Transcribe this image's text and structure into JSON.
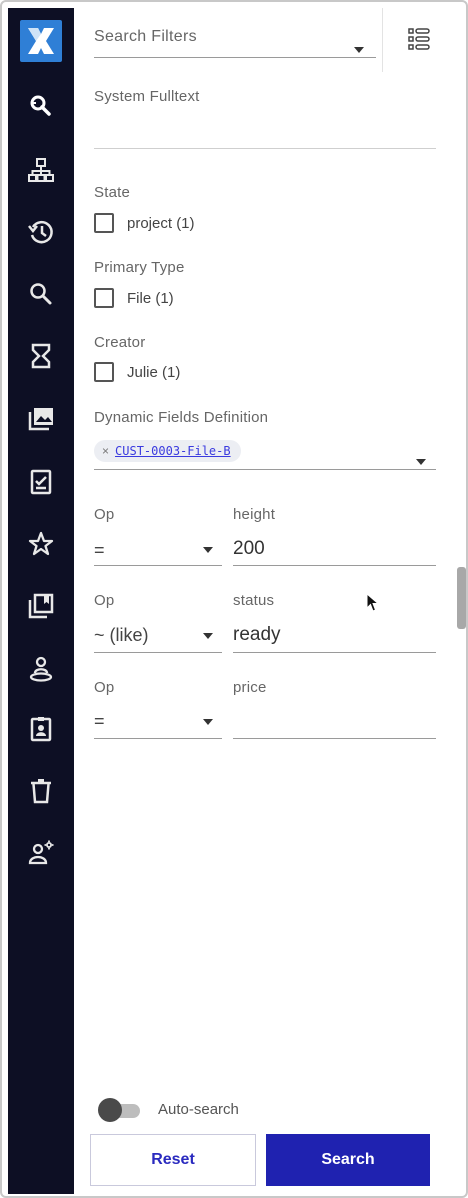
{
  "header": {
    "search_filters_label": "Search Filters"
  },
  "sidebar": {
    "items": [
      {
        "icon": "search-zoom-icon"
      },
      {
        "icon": "hierarchy-icon"
      },
      {
        "icon": "history-icon"
      },
      {
        "icon": "search-icon"
      },
      {
        "icon": "hourglass-icon"
      },
      {
        "icon": "collections-icon"
      },
      {
        "icon": "tasks-icon"
      },
      {
        "icon": "star-icon"
      },
      {
        "icon": "library-icon"
      },
      {
        "icon": "user-location-icon"
      },
      {
        "icon": "badge-icon"
      },
      {
        "icon": "trash-icon"
      },
      {
        "icon": "user-settings-icon"
      }
    ]
  },
  "filters": {
    "fulltext_label": "System Fulltext",
    "state_label": "State",
    "state_option": "project (1)",
    "primary_type_label": "Primary Type",
    "primary_type_option": "File (1)",
    "creator_label": "Creator",
    "creator_option": "Julie (1)",
    "dynamic_label": "Dynamic Fields Definition",
    "dynamic_chip": "CUST-0003-File-B",
    "dynamic_chip_remove": "×",
    "rows": [
      {
        "op_label": "Op",
        "op_value": "=",
        "field_label": "height",
        "field_value": "200"
      },
      {
        "op_label": "Op",
        "op_value": "~ (like)",
        "field_label": "status",
        "field_value": "ready"
      },
      {
        "op_label": "Op",
        "op_value": "=",
        "field_label": "price",
        "field_value": ""
      }
    ]
  },
  "footer": {
    "auto_search_label": "Auto-search",
    "reset_label": "Reset",
    "search_label": "Search"
  },
  "colors": {
    "sidebar_bg": "#0d0f24",
    "logo_bg": "#2f7fd6",
    "primary_button": "#1f22b0",
    "chip_text": "#3a3adf"
  }
}
